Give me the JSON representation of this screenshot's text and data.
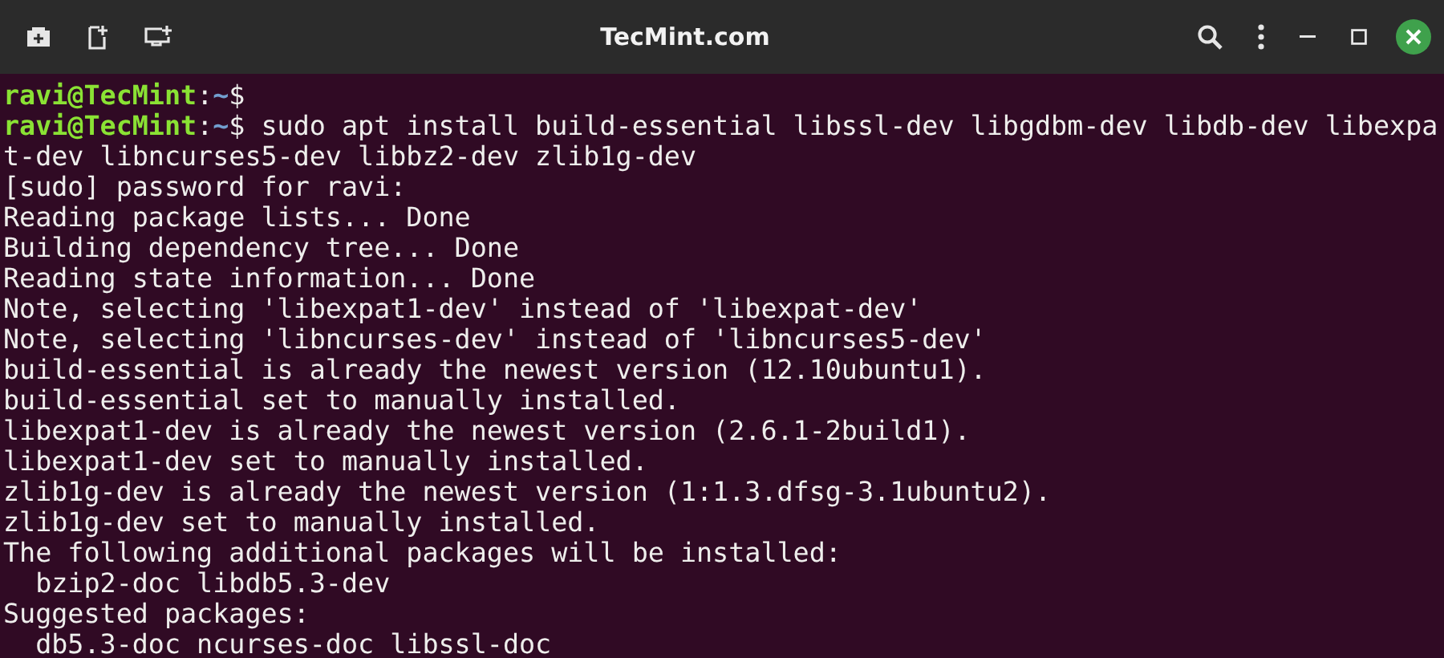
{
  "window": {
    "title": "TecMint.com"
  },
  "terminal": {
    "lines": [
      [
        {
          "kind": "user",
          "text": "ravi@TecMint"
        },
        {
          "kind": "plain",
          "text": ":"
        },
        {
          "kind": "path",
          "text": "~"
        },
        {
          "kind": "plain",
          "text": "$"
        }
      ],
      [
        {
          "kind": "user",
          "text": "ravi@TecMint"
        },
        {
          "kind": "plain",
          "text": ":"
        },
        {
          "kind": "path",
          "text": "~"
        },
        {
          "kind": "plain",
          "text": "$ sudo apt install build-essential libssl-dev libgdbm-dev libdb-dev libexpa"
        }
      ],
      [
        {
          "kind": "plain",
          "text": "t-dev libncurses5-dev libbz2-dev zlib1g-dev"
        }
      ],
      [
        {
          "kind": "plain",
          "text": "[sudo] password for ravi:"
        }
      ],
      [
        {
          "kind": "plain",
          "text": "Reading package lists... Done"
        }
      ],
      [
        {
          "kind": "plain",
          "text": "Building dependency tree... Done"
        }
      ],
      [
        {
          "kind": "plain",
          "text": "Reading state information... Done"
        }
      ],
      [
        {
          "kind": "plain",
          "text": "Note, selecting 'libexpat1-dev' instead of 'libexpat-dev'"
        }
      ],
      [
        {
          "kind": "plain",
          "text": "Note, selecting 'libncurses-dev' instead of 'libncurses5-dev'"
        }
      ],
      [
        {
          "kind": "plain",
          "text": "build-essential is already the newest version (12.10ubuntu1)."
        }
      ],
      [
        {
          "kind": "plain",
          "text": "build-essential set to manually installed."
        }
      ],
      [
        {
          "kind": "plain",
          "text": "libexpat1-dev is already the newest version (2.6.1-2build1)."
        }
      ],
      [
        {
          "kind": "plain",
          "text": "libexpat1-dev set to manually installed."
        }
      ],
      [
        {
          "kind": "plain",
          "text": "zlib1g-dev is already the newest version (1:1.3.dfsg-3.1ubuntu2)."
        }
      ],
      [
        {
          "kind": "plain",
          "text": "zlib1g-dev set to manually installed."
        }
      ],
      [
        {
          "kind": "plain",
          "text": "The following additional packages will be installed:"
        }
      ],
      [
        {
          "kind": "plain",
          "text": "  bzip2-doc libdb5.3-dev"
        }
      ],
      [
        {
          "kind": "plain",
          "text": "Suggested packages:"
        }
      ],
      [
        {
          "kind": "plain",
          "text": "  db5.3-doc ncurses-doc libssl-doc"
        }
      ]
    ]
  }
}
